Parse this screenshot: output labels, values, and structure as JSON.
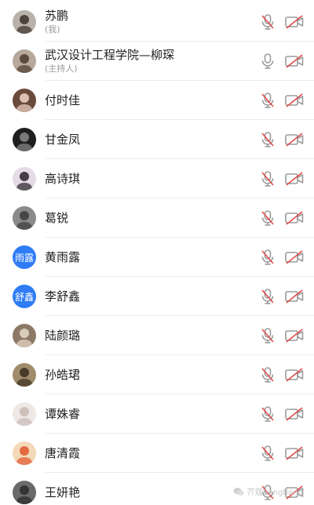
{
  "participants": [
    {
      "name": "苏鹏",
      "role": "(我)",
      "avatar": {
        "type": "photo",
        "bg": "#b9b2aa",
        "fg": "#3a3028"
      },
      "mic": "muted",
      "camera": "off"
    },
    {
      "name": "武汉设计工程学院—柳琛",
      "role": "(主持人)",
      "avatar": {
        "type": "photo",
        "bg": "#b7a89c",
        "fg": "#4a3a30"
      },
      "mic": "on",
      "camera": "off"
    },
    {
      "name": "付时佳",
      "role": "",
      "avatar": {
        "type": "photo",
        "bg": "#6a4a3a",
        "fg": "#f0d6c8"
      },
      "mic": "muted",
      "camera": "off"
    },
    {
      "name": "甘金凤",
      "role": "",
      "avatar": {
        "type": "photo",
        "bg": "#1e1e1e",
        "fg": "#8a8a8a"
      },
      "mic": "muted",
      "camera": "off"
    },
    {
      "name": "高诗琪",
      "role": "",
      "avatar": {
        "type": "photo",
        "bg": "#e4dbe6",
        "fg": "#2a2228"
      },
      "mic": "muted",
      "camera": "off"
    },
    {
      "name": "葛锐",
      "role": "",
      "avatar": {
        "type": "photo",
        "bg": "#8a8a8a",
        "fg": "#3a3a3a"
      },
      "mic": "muted",
      "camera": "off"
    },
    {
      "name": "黄雨露",
      "role": "",
      "avatar": {
        "type": "text",
        "text": "雨露",
        "bg": "#2f7cf6"
      },
      "mic": "muted",
      "camera": "off"
    },
    {
      "name": "李舒鑫",
      "role": "",
      "avatar": {
        "type": "text",
        "text": "舒鑫",
        "bg": "#2f7cf6"
      },
      "mic": "muted",
      "camera": "off"
    },
    {
      "name": "陆颜璐",
      "role": "",
      "avatar": {
        "type": "photo",
        "bg": "#8c7a66",
        "fg": "#e8dccb"
      },
      "mic": "muted",
      "camera": "off"
    },
    {
      "name": "孙皓珺",
      "role": "",
      "avatar": {
        "type": "photo",
        "bg": "#a08c6c",
        "fg": "#3a2c20"
      },
      "mic": "muted",
      "camera": "off"
    },
    {
      "name": "谭姝睿",
      "role": "",
      "avatar": {
        "type": "photo",
        "bg": "#efe9e6",
        "fg": "#c9b9b4"
      },
      "mic": "muted",
      "camera": "off"
    },
    {
      "name": "唐清霞",
      "role": "",
      "avatar": {
        "type": "photo",
        "bg": "#f3d9b8",
        "fg": "#e0552c"
      },
      "mic": "muted",
      "camera": "off"
    },
    {
      "name": "王妍艳",
      "role": "",
      "avatar": {
        "type": "photo",
        "bg": "#6a6a6a",
        "fg": "#2a2a2a"
      },
      "mic": "muted",
      "camera": "off"
    }
  ],
  "watermark": {
    "text": "芥蔻BangBang"
  },
  "colors": {
    "muted_red": "#e04a4a",
    "icon_gray": "#9b9b9b"
  }
}
